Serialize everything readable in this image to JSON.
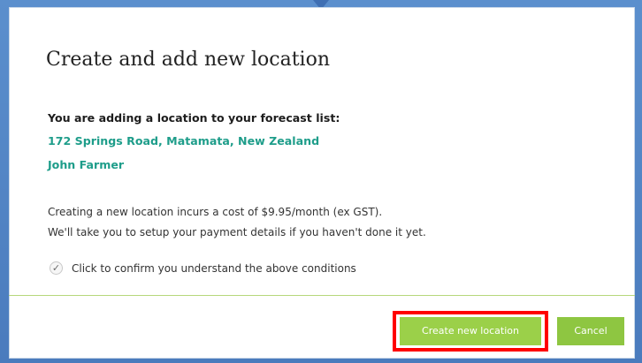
{
  "dialog": {
    "title": "Create and add new location",
    "intro": "You are adding a location to your forecast list:",
    "address": "172 Springs Road, Matamata, New Zealand",
    "owner": "John Farmer",
    "cost_text": "Creating a new location incurs a cost of $9.95/month (ex GST).",
    "payment_text": "We'll take you to setup your payment details if you haven't done it yet.",
    "confirm_label": "Click to confirm you understand the above conditions",
    "confirm_checked": true
  },
  "buttons": {
    "create_label": "Create new location",
    "cancel_label": "Cancel"
  },
  "colors": {
    "accent_green": "#8ec641",
    "link_teal": "#1e9d8a",
    "highlight_red": "#ff0000",
    "frame_blue": "#4d7fc0"
  },
  "icons": {
    "checkbox": "check-icon",
    "pointer": "caret-down-icon"
  }
}
